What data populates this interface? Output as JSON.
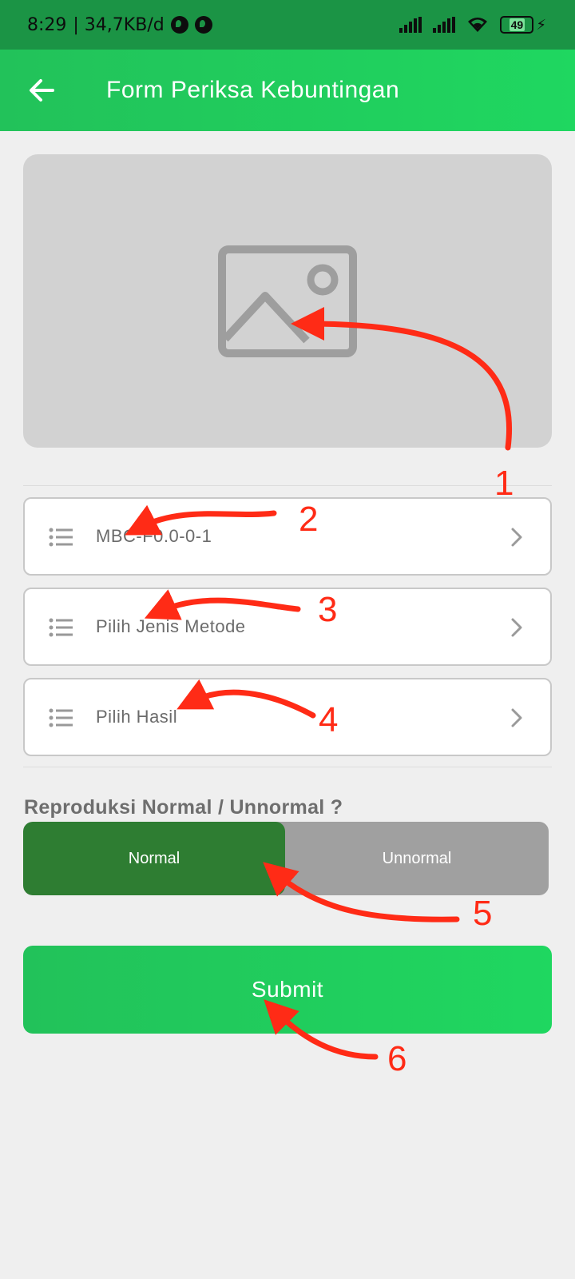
{
  "status_bar": {
    "time": "8:29",
    "speed": "| 34,7KB/d",
    "battery": "49"
  },
  "app_bar": {
    "title": "Form Periksa Kebuntingan",
    "back_icon": "arrow-left-icon"
  },
  "image_picker": {
    "icon": "image-placeholder-icon"
  },
  "selects": [
    {
      "label": "MBC-F0.0-0-1",
      "icon": "list-icon",
      "chevron": "chevron-right-icon"
    },
    {
      "label": "Pilih Jenis Metode",
      "icon": "list-icon",
      "chevron": "chevron-right-icon"
    },
    {
      "label": "Pilih Hasil",
      "icon": "list-icon",
      "chevron": "chevron-right-icon"
    }
  ],
  "reproduction": {
    "question": "Reproduksi Normal / Unnormal ?",
    "options": [
      "Normal",
      "Unnormal"
    ],
    "selected": "Normal"
  },
  "submit_label": "Submit",
  "annotations": [
    "1",
    "2",
    "3",
    "4",
    "5",
    "6"
  ],
  "colors": {
    "primary_green": "#1fd760",
    "status_green": "#1b9445",
    "selected_dark_green": "#2e7d32",
    "unselected_gray": "#a0a0a0",
    "annotation_red": "#ff2b16"
  }
}
